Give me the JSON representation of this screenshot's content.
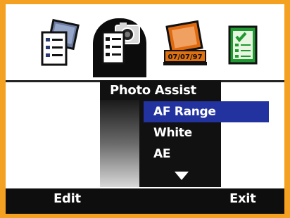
{
  "tabs": [
    {
      "name": "review-photos",
      "icon": "photo-list-icon"
    },
    {
      "name": "photo-assist",
      "icon": "camera-menu-icon",
      "selected": true
    },
    {
      "name": "date-stamp",
      "icon": "date-stamp-icon",
      "stamp_text": "07/07/97"
    },
    {
      "name": "checklist",
      "icon": "checklist-icon"
    }
  ],
  "menu": {
    "title": "Photo Assist",
    "items": [
      "AF Range",
      "White Balance",
      "AE Metering"
    ],
    "selected_index": 0
  },
  "softkeys": {
    "left": "Edit",
    "right": "Exit"
  },
  "colors": {
    "frame": "#f4a020",
    "highlight": "#2233a0",
    "panel": "#111111"
  }
}
